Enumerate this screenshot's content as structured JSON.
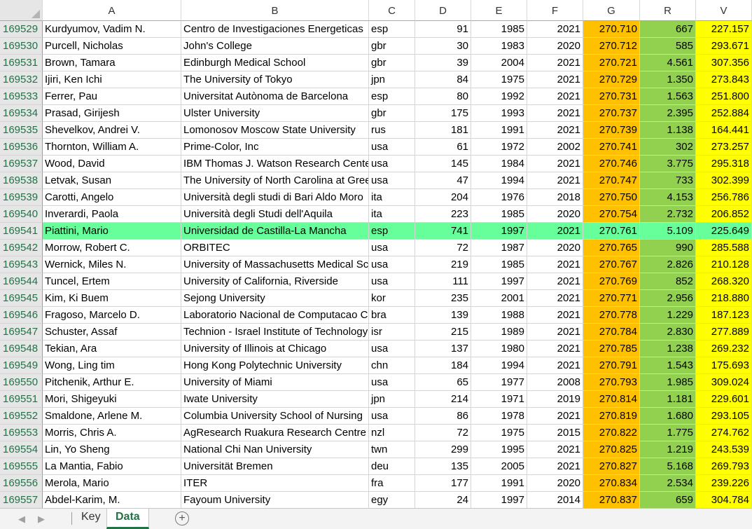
{
  "columns": [
    "A",
    "B",
    "C",
    "D",
    "E",
    "F",
    "G",
    "R",
    "V"
  ],
  "colors": {
    "G": "#ffc000",
    "R": "#92d050",
    "V": "#ffff00",
    "highlight": "#66ff99",
    "accent": "#217346"
  },
  "rows": [
    {
      "n": "169529",
      "A": "Kurdyumov, Vadim N.",
      "B": "Centro de Investigaciones Energeticas",
      "C": "esp",
      "D": "91",
      "E": "1985",
      "F": "2021",
      "G": "270.710",
      "R": "667",
      "V": "227.157"
    },
    {
      "n": "169530",
      "A": "Purcell, Nicholas",
      "B": "John's College",
      "C": "gbr",
      "D": "30",
      "E": "1983",
      "F": "2020",
      "G": "270.712",
      "R": "585",
      "V": "293.671"
    },
    {
      "n": "169531",
      "A": "Brown, Tamara",
      "B": "Edinburgh Medical School",
      "C": "gbr",
      "D": "39",
      "E": "2004",
      "F": "2021",
      "G": "270.721",
      "R": "4.561",
      "V": "307.356"
    },
    {
      "n": "169532",
      "A": "Ijiri, Ken Ichi",
      "B": "The University of Tokyo",
      "C": "jpn",
      "D": "84",
      "E": "1975",
      "F": "2021",
      "G": "270.729",
      "R": "1.350",
      "V": "273.843"
    },
    {
      "n": "169533",
      "A": "Ferrer, Pau",
      "B": "Universitat Autònoma de Barcelona",
      "C": "esp",
      "D": "80",
      "E": "1992",
      "F": "2021",
      "G": "270.731",
      "R": "1.563",
      "V": "251.800"
    },
    {
      "n": "169534",
      "A": "Prasad, Girijesh",
      "B": "Ulster University",
      "C": "gbr",
      "D": "175",
      "E": "1993",
      "F": "2021",
      "G": "270.737",
      "R": "2.395",
      "V": "252.884"
    },
    {
      "n": "169535",
      "A": "Shevelkov, Andrei V.",
      "B": "Lomonosov Moscow State University",
      "C": "rus",
      "D": "181",
      "E": "1991",
      "F": "2021",
      "G": "270.739",
      "R": "1.138",
      "V": "164.441"
    },
    {
      "n": "169536",
      "A": "Thornton, William A.",
      "B": "Prime-Color, Inc",
      "C": "usa",
      "D": "61",
      "E": "1972",
      "F": "2002",
      "G": "270.741",
      "R": "302",
      "V": "273.257"
    },
    {
      "n": "169537",
      "A": "Wood, David",
      "B": "IBM Thomas J. Watson Research Center",
      "C": "usa",
      "D": "145",
      "E": "1984",
      "F": "2021",
      "G": "270.746",
      "R": "3.775",
      "V": "295.318"
    },
    {
      "n": "169538",
      "A": "Letvak, Susan",
      "B": "The University of North Carolina at Greensboro",
      "C": "usa",
      "D": "47",
      "E": "1994",
      "F": "2021",
      "G": "270.747",
      "R": "733",
      "V": "302.399"
    },
    {
      "n": "169539",
      "A": "Carotti, Angelo",
      "B": "Università degli studi di Bari Aldo Moro",
      "C": "ita",
      "D": "204",
      "E": "1976",
      "F": "2018",
      "G": "270.750",
      "R": "4.153",
      "V": "256.786"
    },
    {
      "n": "169540",
      "A": "Inverardi, Paola",
      "B": "Università degli Studi dell'Aquila",
      "C": "ita",
      "D": "223",
      "E": "1985",
      "F": "2020",
      "G": "270.754",
      "R": "2.732",
      "V": "206.852"
    },
    {
      "n": "169541",
      "A": "Piattini, Mario",
      "B": "Universidad de Castilla-La Mancha",
      "C": "esp",
      "D": "741",
      "E": "1997",
      "F": "2021",
      "G": "270.761",
      "R": "5.109",
      "V": "225.649",
      "hl": true
    },
    {
      "n": "169542",
      "A": "Morrow, Robert C.",
      "B": "ORBITEC",
      "C": "usa",
      "D": "72",
      "E": "1987",
      "F": "2020",
      "G": "270.765",
      "R": "990",
      "V": "285.588"
    },
    {
      "n": "169543",
      "A": "Wernick, Miles N.",
      "B": "University of Massachusetts Medical School",
      "C": "usa",
      "D": "219",
      "E": "1985",
      "F": "2021",
      "G": "270.767",
      "R": "2.826",
      "V": "210.128"
    },
    {
      "n": "169544",
      "A": "Tuncel, Ertem",
      "B": "University of California, Riverside",
      "C": "usa",
      "D": "111",
      "E": "1997",
      "F": "2021",
      "G": "270.769",
      "R": "852",
      "V": "268.320"
    },
    {
      "n": "169545",
      "A": "Kim, Ki Buem",
      "B": "Sejong University",
      "C": "kor",
      "D": "235",
      "E": "2001",
      "F": "2021",
      "G": "270.771",
      "R": "2.956",
      "V": "218.880"
    },
    {
      "n": "169546",
      "A": "Fragoso, Marcelo D.",
      "B": "Laboratorio Nacional de Computacao Cientifica",
      "C": "bra",
      "D": "139",
      "E": "1988",
      "F": "2021",
      "G": "270.778",
      "R": "1.229",
      "V": "187.123"
    },
    {
      "n": "169547",
      "A": "Schuster, Assaf",
      "B": "Technion - Israel Institute of Technology",
      "C": "isr",
      "D": "215",
      "E": "1989",
      "F": "2021",
      "G": "270.784",
      "R": "2.830",
      "V": "277.889"
    },
    {
      "n": "169548",
      "A": "Tekian, Ara",
      "B": "University of Illinois at Chicago",
      "C": "usa",
      "D": "137",
      "E": "1980",
      "F": "2021",
      "G": "270.785",
      "R": "1.238",
      "V": "269.232"
    },
    {
      "n": "169549",
      "A": "Wong, Ling tim",
      "B": "Hong Kong Polytechnic University",
      "C": "chn",
      "D": "184",
      "E": "1994",
      "F": "2021",
      "G": "270.791",
      "R": "1.543",
      "V": "175.693"
    },
    {
      "n": "169550",
      "A": "Pitchenik, Arthur E.",
      "B": "University of Miami",
      "C": "usa",
      "D": "65",
      "E": "1977",
      "F": "2008",
      "G": "270.793",
      "R": "1.985",
      "V": "309.024"
    },
    {
      "n": "169551",
      "A": "Mori, Shigeyuki",
      "B": "Iwate University",
      "C": "jpn",
      "D": "214",
      "E": "1971",
      "F": "2019",
      "G": "270.814",
      "R": "1.181",
      "V": "229.601"
    },
    {
      "n": "169552",
      "A": "Smaldone, Arlene M.",
      "B": "Columbia University School of Nursing",
      "C": "usa",
      "D": "86",
      "E": "1978",
      "F": "2021",
      "G": "270.819",
      "R": "1.680",
      "V": "293.105"
    },
    {
      "n": "169553",
      "A": "Morris, Chris A.",
      "B": "AgResearch Ruakura Research Centre",
      "C": "nzl",
      "D": "72",
      "E": "1975",
      "F": "2015",
      "G": "270.822",
      "R": "1.775",
      "V": "274.762"
    },
    {
      "n": "169554",
      "A": "Lin, Yo Sheng",
      "B": "National Chi Nan University",
      "C": "twn",
      "D": "299",
      "E": "1995",
      "F": "2021",
      "G": "270.825",
      "R": "1.219",
      "V": "243.539"
    },
    {
      "n": "169555",
      "A": "La Mantia, Fabio",
      "B": "Universität Bremen",
      "C": "deu",
      "D": "135",
      "E": "2005",
      "F": "2021",
      "G": "270.827",
      "R": "5.168",
      "V": "269.793"
    },
    {
      "n": "169556",
      "A": "Merola, Mario",
      "B": "ITER",
      "C": "fra",
      "D": "177",
      "E": "1991",
      "F": "2020",
      "G": "270.834",
      "R": "2.534",
      "V": "239.226"
    },
    {
      "n": "169557",
      "A": "Abdel-Karim, M.",
      "B": "Fayoum University",
      "C": "egy",
      "D": "24",
      "E": "1997",
      "F": "2014",
      "G": "270.837",
      "R": "659",
      "V": "304.784"
    }
  ],
  "tabs": {
    "key": "Key",
    "data": "Data",
    "add": "+",
    "prev": "◀",
    "next": "▶"
  }
}
